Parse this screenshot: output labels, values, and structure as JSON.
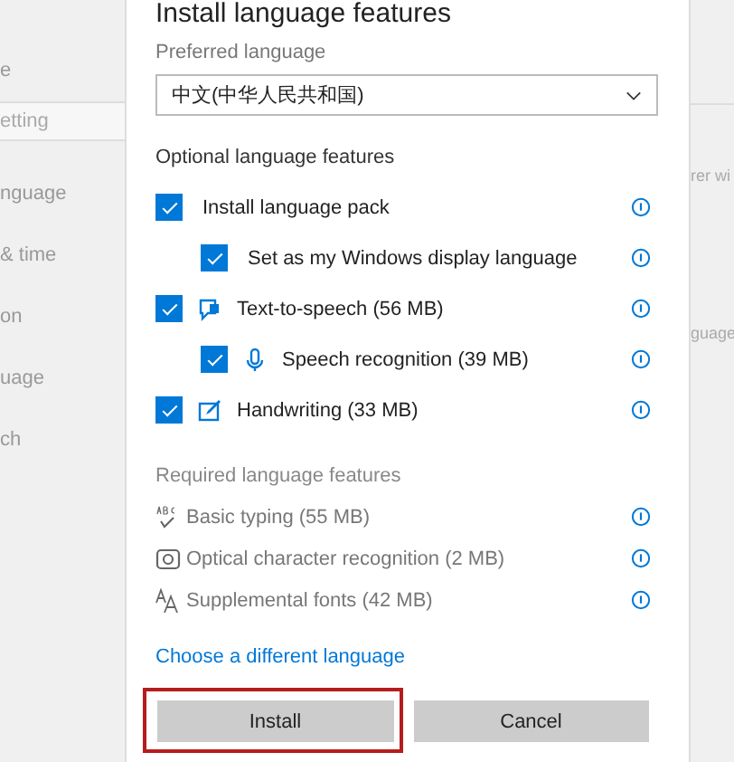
{
  "background": {
    "sidebar": [
      {
        "kind": "text",
        "label": "e"
      },
      {
        "kind": "search",
        "label": "etting"
      },
      {
        "kind": "text",
        "label": "nguage"
      },
      {
        "kind": "text",
        "label": "& time"
      },
      {
        "kind": "text",
        "label": "on"
      },
      {
        "kind": "text",
        "label": "uage"
      },
      {
        "kind": "text",
        "label": "ch"
      }
    ],
    "right_texts": [
      "rer wi",
      "guage"
    ]
  },
  "dialog": {
    "title": "Install language features",
    "preferred_language": {
      "label": "Preferred language",
      "value": "中文(中华人民共和国)"
    },
    "optional_heading": "Optional language features",
    "optional_features": [
      {
        "kind": "language_pack",
        "label": "Install language pack",
        "checked": true,
        "children": [
          {
            "kind": "display_language",
            "label": "Set as my Windows display language",
            "checked": true
          }
        ]
      },
      {
        "kind": "text_to_speech",
        "label": "Text-to-speech (56 MB)",
        "checked": true,
        "children": [
          {
            "kind": "speech",
            "label": "Speech recognition (39 MB)",
            "checked": true
          }
        ]
      },
      {
        "kind": "handwriting",
        "label": "Handwriting (33 MB)",
        "checked": true
      }
    ],
    "required_heading": "Required language features",
    "required_features": [
      {
        "kind": "typing",
        "label": "Basic typing (55 MB)"
      },
      {
        "kind": "ocr",
        "label": "Optical character recognition (2 MB)"
      },
      {
        "kind": "fonts",
        "label": "Supplemental fonts (42 MB)"
      }
    ],
    "link": "Choose a different language",
    "buttons": [
      {
        "label": "Install",
        "highlighted": true
      },
      {
        "label": "Cancel",
        "highlighted": false
      }
    ]
  }
}
